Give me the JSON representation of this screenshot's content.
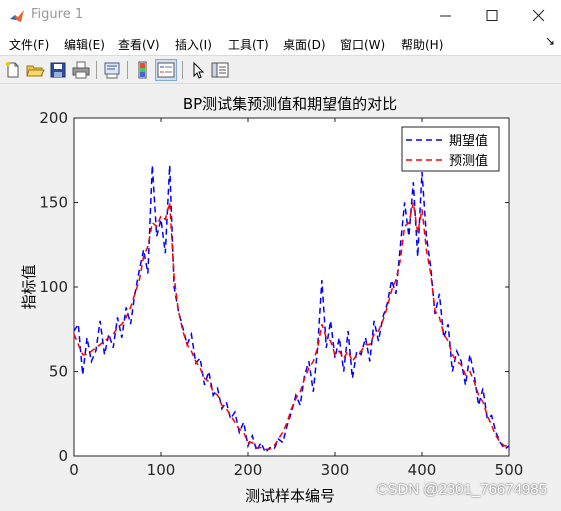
{
  "window": {
    "title": "Figure 1"
  },
  "menu": [
    "文件(F)",
    "编辑(E)",
    "查看(V)",
    "插入(I)",
    "工具(T)",
    "桌面(D)",
    "窗口(W)",
    "帮助(H)"
  ],
  "menu_overflow": "↘",
  "toolbar": [
    "new-file",
    "open-file",
    "save",
    "print",
    "print-preview",
    "colorbar",
    "legend",
    "pointer",
    "property-editor"
  ],
  "figure": {
    "background": "#f0f0f0"
  },
  "chart_data": {
    "type": "line",
    "title": "BP测试集预测值和期望值的对比",
    "xlabel": "测试样本编号",
    "ylabel": "指标值",
    "xlim": [
      0,
      500
    ],
    "ylim": [
      0,
      200
    ],
    "xticks": [
      0,
      100,
      200,
      300,
      400,
      500
    ],
    "yticks": [
      0,
      50,
      100,
      150,
      200
    ],
    "legend_position": "top-right",
    "grid": false,
    "series": [
      {
        "name": "期望值",
        "color": "#0000ff",
        "style": "dashed",
        "x": [
          0,
          5,
          10,
          15,
          20,
          25,
          30,
          35,
          40,
          45,
          50,
          55,
          60,
          65,
          70,
          75,
          80,
          85,
          90,
          95,
          100,
          105,
          110,
          115,
          120,
          125,
          130,
          135,
          140,
          145,
          150,
          155,
          160,
          165,
          170,
          175,
          180,
          185,
          190,
          195,
          200,
          205,
          210,
          215,
          220,
          225,
          230,
          235,
          240,
          245,
          250,
          255,
          260,
          265,
          270,
          275,
          280,
          285,
          290,
          295,
          300,
          305,
          310,
          315,
          320,
          325,
          330,
          335,
          340,
          345,
          350,
          355,
          360,
          365,
          370,
          375,
          380,
          385,
          390,
          395,
          400,
          405,
          410,
          415,
          420,
          425,
          430,
          435,
          440,
          445,
          450,
          455,
          460,
          465,
          470,
          475,
          480,
          485,
          490,
          495,
          500
        ],
        "values": [
          74,
          78,
          48,
          70,
          56,
          62,
          80,
          60,
          72,
          64,
          82,
          70,
          88,
          78,
          96,
          110,
          122,
          108,
          172,
          130,
          140,
          120,
          172,
          100,
          86,
          76,
          66,
          72,
          55,
          58,
          42,
          50,
          36,
          40,
          28,
          32,
          22,
          26,
          14,
          20,
          6,
          12,
          3,
          8,
          2,
          5,
          4,
          10,
          8,
          18,
          26,
          36,
          30,
          48,
          56,
          38,
          64,
          104,
          64,
          80,
          58,
          70,
          50,
          74,
          46,
          62,
          60,
          70,
          56,
          80,
          68,
          82,
          90,
          104,
          96,
          124,
          150,
          130,
          162,
          118,
          168,
          130,
          112,
          84,
          96,
          70,
          78,
          50,
          62,
          56,
          42,
          60,
          48,
          30,
          40,
          22,
          24,
          14,
          8,
          4,
          6
        ]
      },
      {
        "name": "预测值",
        "color": "#ff0000",
        "style": "dashed",
        "x": [
          0,
          5,
          10,
          15,
          20,
          25,
          30,
          35,
          40,
          45,
          50,
          55,
          60,
          65,
          70,
          75,
          80,
          85,
          90,
          95,
          100,
          105,
          110,
          115,
          120,
          125,
          130,
          135,
          140,
          145,
          150,
          155,
          160,
          165,
          170,
          175,
          180,
          185,
          190,
          195,
          200,
          205,
          210,
          215,
          220,
          225,
          230,
          235,
          240,
          245,
          250,
          255,
          260,
          265,
          270,
          275,
          280,
          285,
          290,
          295,
          300,
          305,
          310,
          315,
          320,
          325,
          330,
          335,
          340,
          345,
          350,
          355,
          360,
          365,
          370,
          375,
          380,
          385,
          390,
          395,
          400,
          405,
          410,
          415,
          420,
          425,
          430,
          435,
          440,
          445,
          450,
          455,
          460,
          465,
          470,
          475,
          480,
          485,
          490,
          495,
          500
        ],
        "values": [
          72,
          66,
          60,
          60,
          62,
          64,
          66,
          68,
          70,
          72,
          76,
          78,
          82,
          88,
          96,
          104,
          118,
          124,
          138,
          136,
          142,
          140,
          150,
          106,
          86,
          74,
          66,
          62,
          56,
          52,
          46,
          44,
          38,
          36,
          30,
          28,
          24,
          20,
          16,
          14,
          8,
          8,
          5,
          5,
          4,
          4,
          6,
          10,
          14,
          20,
          28,
          34,
          38,
          46,
          52,
          56,
          64,
          78,
          70,
          68,
          60,
          62,
          58,
          62,
          56,
          60,
          62,
          66,
          66,
          72,
          74,
          80,
          88,
          98,
          104,
          116,
          136,
          138,
          150,
          132,
          146,
          122,
          108,
          86,
          82,
          72,
          68,
          60,
          56,
          54,
          48,
          50,
          44,
          36,
          32,
          24,
          18,
          12,
          8,
          6,
          6
        ]
      }
    ]
  },
  "watermark": "CSDN @2301_76674985"
}
